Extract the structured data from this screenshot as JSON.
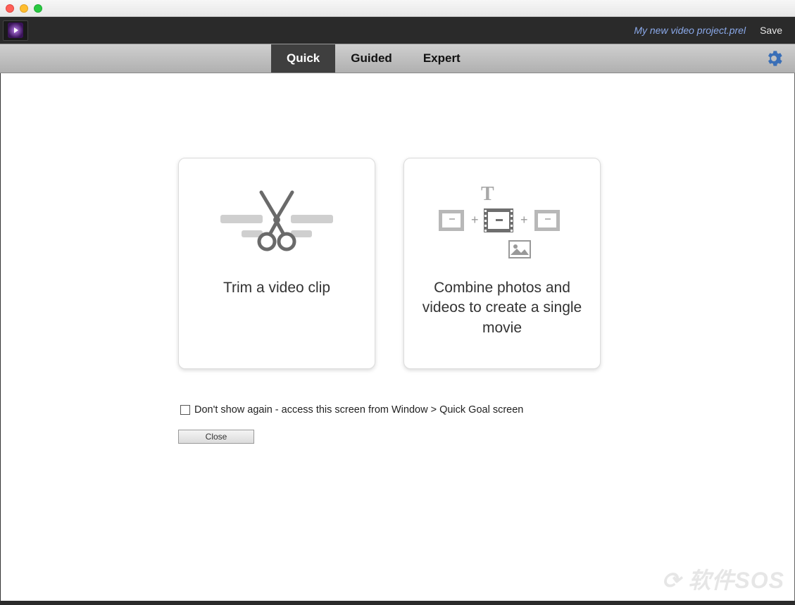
{
  "header": {
    "project_name": "My new video project.prel",
    "save_label": "Save"
  },
  "tabs": {
    "items": [
      {
        "label": "Quick",
        "active": true
      },
      {
        "label": "Guided",
        "active": false
      },
      {
        "label": "Expert",
        "active": false
      }
    ]
  },
  "cards": {
    "trim": {
      "title": "Trim a video clip"
    },
    "combine": {
      "title": "Combine photos and videos to create a single movie"
    }
  },
  "dontshow": {
    "label": "Don't show again - access this screen from Window > Quick Goal screen"
  },
  "buttons": {
    "close": "Close"
  },
  "watermark": "软件SOS"
}
